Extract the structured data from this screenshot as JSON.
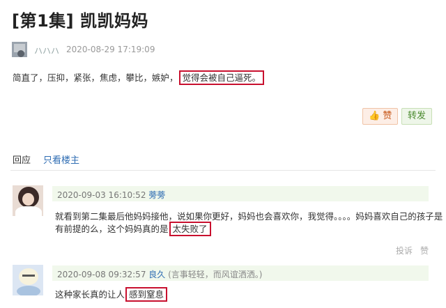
{
  "post": {
    "title": "[第1集] 凯凯妈妈",
    "author": "ハハハ",
    "time": "2020-08-29 17:19:09",
    "body_prefix": "简直了，压抑，紧张，焦虑，攀比，嫉妒，",
    "body_highlight": "觉得会被自己逼死。",
    "like_label": "赞",
    "share_label": "转发",
    "like_icon": "thumbs-up-icon"
  },
  "tabs": {
    "reply": "回应",
    "only_op": "只看楼主"
  },
  "comments": [
    {
      "time": "2020-09-03 16:10:52",
      "name": "蒡蒡",
      "line1": "就看到第二集最后他妈妈接他，说如果你更好，妈妈也会喜欢你，我觉得。。。。妈妈喜欢自己的孩子是",
      "line2_prefix": "有前提的么，这个妈妈真的是",
      "line2_highlight": "太失败了",
      "report": "投诉",
      "like": "赞"
    },
    {
      "time": "2020-09-08 09:32:57",
      "name": "良久",
      "note": "(言事轻轻，而风谊洒洒。)",
      "line1_prefix": "这种家长真的让人",
      "line1_highlight": "感到窒息"
    }
  ],
  "colors": {
    "highlight_border": "#c8102e",
    "link": "#2f6db3",
    "comment_header_bg": "#f1f8ec"
  }
}
